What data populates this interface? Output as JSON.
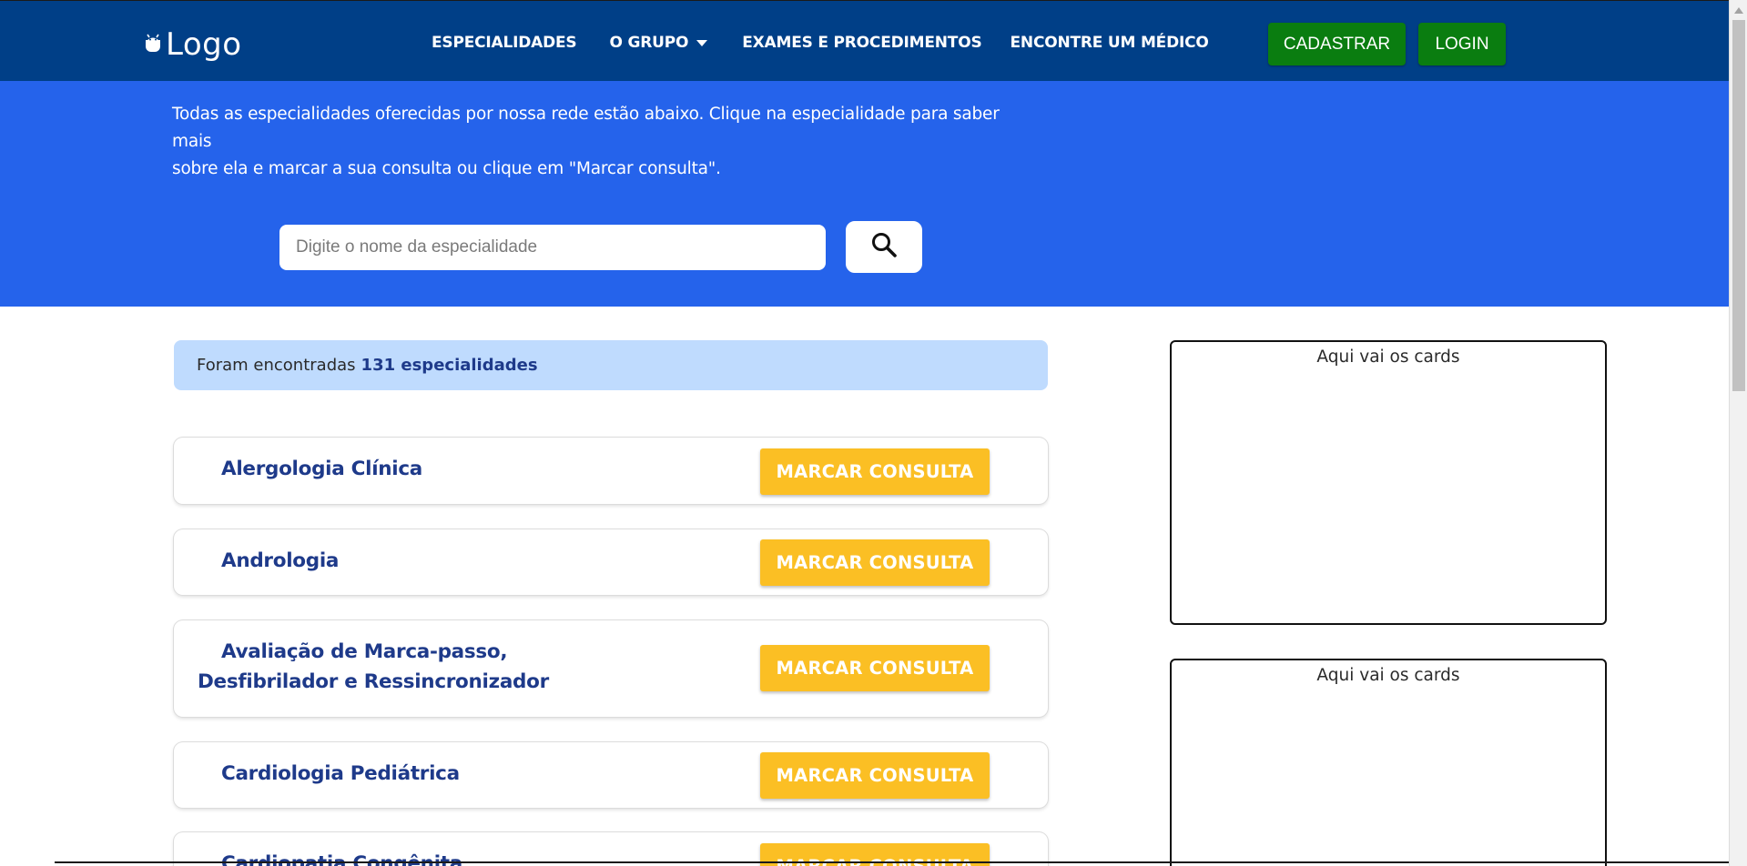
{
  "header": {
    "logo_text": "Logo",
    "nav": [
      {
        "label": "ESPECIALIDADES"
      },
      {
        "label": "O GRUPO",
        "has_dropdown": true
      },
      {
        "label": "EXAMES E PROCEDIMENTOS"
      },
      {
        "label": "ENCONTRE UM MÉDICO"
      }
    ],
    "register_label": "CADASTRAR",
    "login_label": "LOGIN"
  },
  "hero": {
    "text_line1": "Todas as especialidades oferecidas por nossa rede estão abaixo. Clique na especialidade para saber mais",
    "text_line2": "sobre ela e marcar a sua consulta ou clique em \"Marcar consulta\".",
    "search_placeholder": "Digite o nome da especialidade",
    "search_icon": "search-icon"
  },
  "results": {
    "prefix": "Foram encontradas",
    "count_text": "131 especialidades"
  },
  "specialties": [
    {
      "name": "Alergologia Clínica",
      "button_label": "MARCAR CONSULTA"
    },
    {
      "name": "Andrologia",
      "button_label": "MARCAR CONSULTA"
    },
    {
      "name_line1": "Avaliação de Marca-passo,",
      "name_line2": "Desfibrilador e Ressincronizador",
      "button_label": "MARCAR CONSULTA"
    },
    {
      "name": "Cardiologia Pediátrica",
      "button_label": "MARCAR CONSULTA"
    },
    {
      "name": "Cardiopatia Congênita",
      "button_label": "MARCAR CONSULTA"
    }
  ],
  "sidebar": {
    "cards": [
      {
        "text": "Aqui vai os cards"
      },
      {
        "text": "Aqui vai os cards"
      }
    ]
  },
  "colors": {
    "navbar": "#003f87",
    "hero": "#2563eb",
    "green_button": "#0a7d10",
    "yellow_button": "#fbbf24",
    "result_bar": "#bfdbfe",
    "specialty_text": "#1e3a8a"
  }
}
